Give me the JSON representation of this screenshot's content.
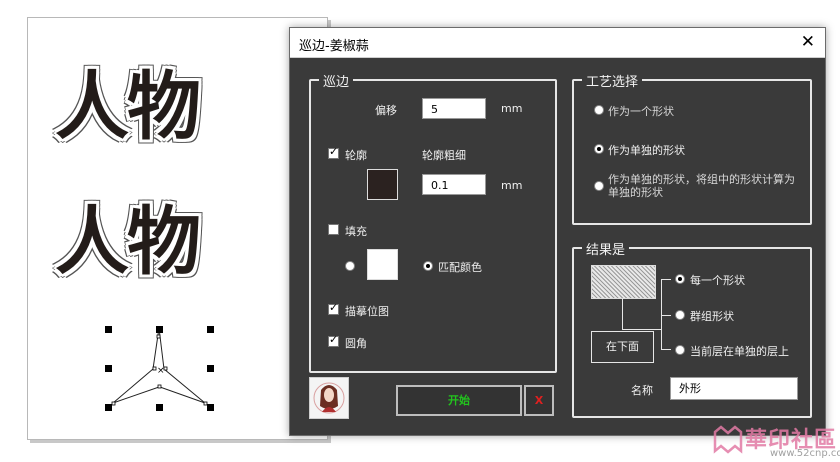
{
  "canvas": {
    "art_text_1": "人物",
    "art_text_2": "人物"
  },
  "dialog": {
    "title": "巡边-姜椒蒜",
    "close_glyph": "✕",
    "patrol_group": {
      "legend": "巡边",
      "offset_label": "偏移",
      "offset_value": "5",
      "offset_unit": "mm",
      "outline_label": "轮廓",
      "outline_checked": true,
      "outline_width_label": "轮廓粗细",
      "outline_width_value": "0.1",
      "outline_width_unit": "mm",
      "outline_color": "#2b2220",
      "fill_label": "填充",
      "fill_checked": false,
      "fill_color": "#ffffff",
      "match_color_label": "匹配颜色",
      "trace_bitmap_label": "描摹位图",
      "trace_bitmap_checked": true,
      "round_corner_label": "圆角",
      "round_corner_checked": true
    },
    "process_group": {
      "legend": "工艺选择",
      "options": [
        "作为一个形状",
        "作为单独的形状",
        "作为单独的形状，将组中的形状计算为单独的形状"
      ],
      "selected_index": 1
    },
    "result_group": {
      "legend": "结果是",
      "below_button": "在下面",
      "options": [
        "每一个形状",
        "群组形状",
        "当前层在单独的层上"
      ],
      "selected_index": 0,
      "name_label": "名称",
      "name_value": "外形"
    },
    "start_button": "开始",
    "cancel_button": "X",
    "start_color": "#22c31e",
    "cancel_color": "#e02020"
  },
  "watermark": {
    "text": "華印社區",
    "url": "www.52cnp.com"
  }
}
